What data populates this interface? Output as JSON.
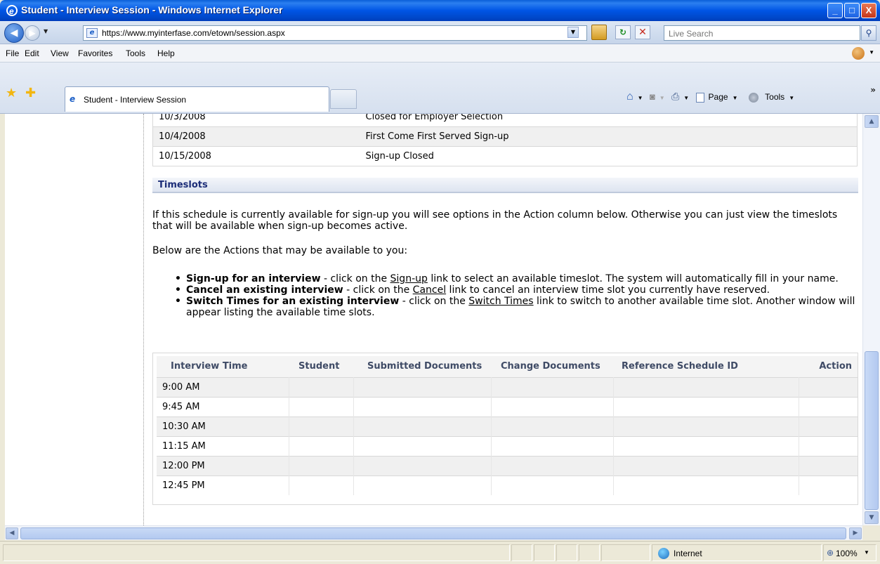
{
  "window": {
    "title": "Student - Interview Session - Windows Internet Explorer",
    "minimize": "_",
    "maximize": "□",
    "close": "X"
  },
  "address": {
    "url": "https://www.myinterfase.com/etown/session.aspx",
    "search_placeholder": "Live Search"
  },
  "menu": {
    "items": [
      "File",
      "Edit",
      "View",
      "Favorites",
      "Tools",
      "Help"
    ]
  },
  "tab": {
    "label": "Student - Interview Session"
  },
  "commandbar": {
    "page_label": "Page",
    "tools_label": "Tools"
  },
  "phases": [
    {
      "date": "10/3/2008",
      "status": "Closed for Employer Selection"
    },
    {
      "date": "10/4/2008",
      "status": "First Come First Served Sign-up"
    },
    {
      "date": "10/15/2008",
      "status": "Sign-up Closed"
    }
  ],
  "timeslots": {
    "header": "Timeslots",
    "intro": "If this schedule is currently available for sign-up you will see options in the Action column below. Otherwise you can just view the timeslots that will be available when sign-up becomes active.",
    "actions_intro": "Below are the Actions that may be available to you:",
    "actions": [
      {
        "title": "Sign-up for an interview",
        "pre": " - click on the ",
        "link": "Sign-up",
        "post": " link to select an available timeslot. The system will automatically fill in your name."
      },
      {
        "title": "Cancel an existing interview",
        "pre": " - click on the ",
        "link": "Cancel",
        "post": " link to cancel an interview time slot you currently have reserved."
      },
      {
        "title": "Switch Times for an existing interview",
        "pre": " - click on the ",
        "link": "Switch Times",
        "post": " link to switch to another available time slot. Another window will appear listing the available time slots."
      }
    ],
    "columns": [
      "Interview Time",
      "Student",
      "Submitted Documents",
      "Change Documents",
      "Reference Schedule ID",
      "Action"
    ],
    "rows": [
      "9:00 AM",
      "9:45 AM",
      "10:30 AM",
      "11:15 AM",
      "12:00 PM",
      "12:45 PM"
    ]
  },
  "status": {
    "zone": "Internet",
    "zoom": "100%"
  }
}
